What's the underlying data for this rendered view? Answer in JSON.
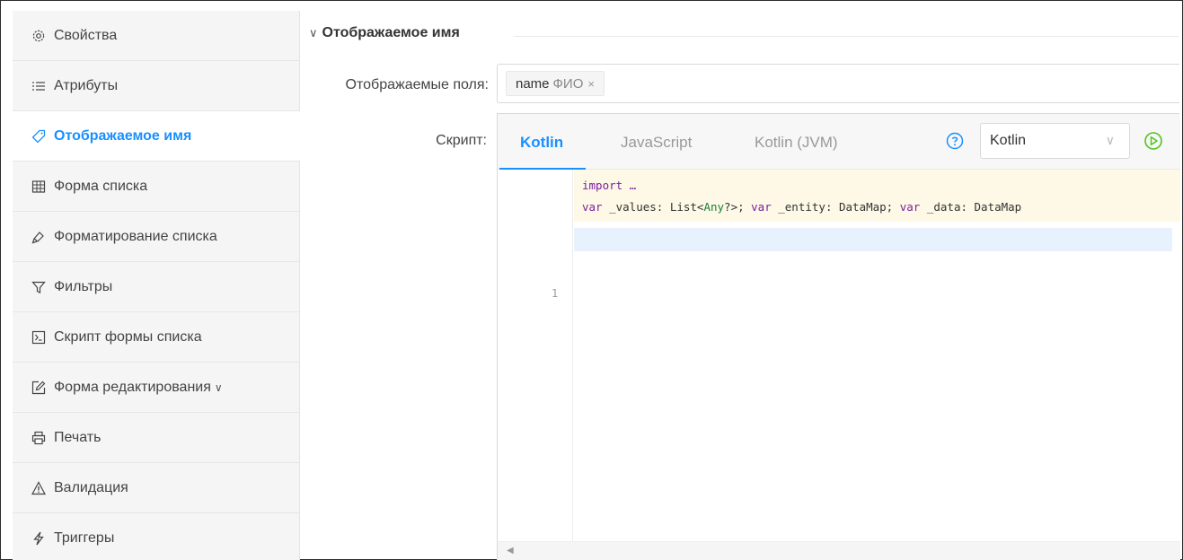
{
  "sidebar": {
    "items": [
      {
        "label": "Свойства",
        "icon": "gear-icon"
      },
      {
        "label": "Атрибуты",
        "icon": "list-icon"
      },
      {
        "label": "Отображаемое имя",
        "icon": "tag-icon",
        "active": true
      },
      {
        "label": "Форма списка",
        "icon": "table-icon"
      },
      {
        "label": "Форматирование списка",
        "icon": "paint-icon"
      },
      {
        "label": "Фильтры",
        "icon": "filter-icon"
      },
      {
        "label": "Скрипт формы списка",
        "icon": "terminal-icon"
      },
      {
        "label": "Форма редактирования",
        "icon": "edit-icon",
        "chevron": "∨"
      },
      {
        "label": "Печать",
        "icon": "printer-icon"
      },
      {
        "label": "Валидация",
        "icon": "warning-icon"
      },
      {
        "label": "Триггеры",
        "icon": "lightning-icon"
      }
    ]
  },
  "section": {
    "chevron": "∨",
    "title": "Отображаемое имя"
  },
  "fields": {
    "label": "Отображаемые поля:",
    "tags": [
      {
        "name": "name",
        "caption": "ФИО",
        "close": "×"
      }
    ]
  },
  "script": {
    "label": "Скрипт:",
    "tabs": [
      {
        "label": "Kotlin",
        "active": true
      },
      {
        "label": "JavaScript"
      },
      {
        "label": "Kotlin (JVM)"
      }
    ],
    "language_select": {
      "value": "Kotlin"
    },
    "code_header": {
      "line1": "import …",
      "line2_parts": [
        "var",
        " _values: List<",
        "Any",
        "?>; ",
        "var",
        " _entity: DataMap; ",
        "var",
        " _data: DataMap"
      ]
    },
    "line_numbers": [
      "1"
    ]
  },
  "colors": {
    "accent": "#1890ff",
    "header_bg": "#fdf9e6",
    "active_line_bg": "#e8f2ff"
  }
}
